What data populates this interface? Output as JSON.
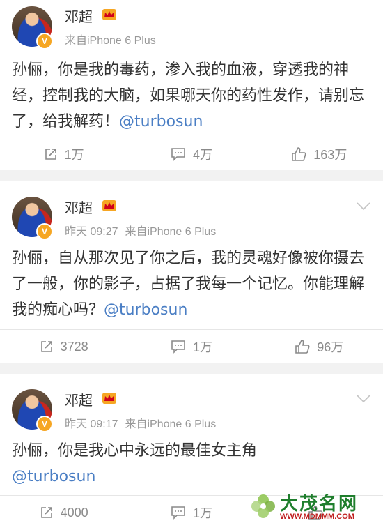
{
  "posts": [
    {
      "author": "邓超",
      "time": "",
      "source": "来自iPhone 6 Plus",
      "text": "孙俪，你是我的毒药，渗入我的血液，穿透我的神经，控制我的大脑，如果哪天你的药性发作，请别忘了，给我解药！",
      "mention": "@turbosun",
      "reposts": "1万",
      "comments": "4万",
      "likes": "163万"
    },
    {
      "author": "邓超",
      "time": "昨天 09:27",
      "source": "来自iPhone 6 Plus",
      "text": "孙俪，自从那次见了你之后，我的灵魂好像被你摄去了一般，你的影子，占据了我每一个记忆。你能理解我的痴心吗？",
      "mention": "@turbosun",
      "reposts": "3728",
      "comments": "1万",
      "likes": "96万"
    },
    {
      "author": "邓超",
      "time": "昨天 09:17",
      "source": "来自iPhone 6 Plus",
      "text": "孙俪，你是我心中永远的最佳女主角",
      "mention": "@turbosun",
      "reposts": "4000",
      "comments": "1万",
      "likes": ""
    }
  ],
  "watermark": {
    "title": "大茂名网",
    "url": "WWW.MDMMM.COM"
  },
  "colors": {
    "mention": "#4a7ec4",
    "badge": "#f6a623",
    "meta": "#999999"
  },
  "icons": [
    "verified-v-icon",
    "vip-crown-icon",
    "chevron-down-icon",
    "repost-icon",
    "comment-icon",
    "like-icon"
  ]
}
